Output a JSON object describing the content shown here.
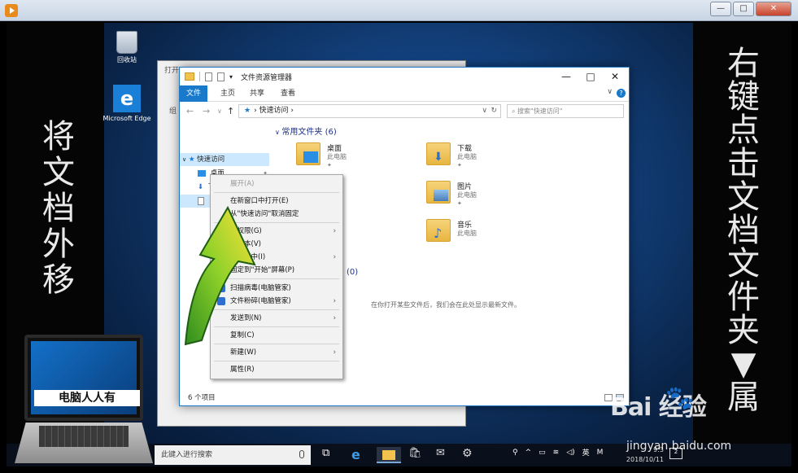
{
  "outer_window": {
    "controls": {
      "minimize": "—",
      "maximize": "□",
      "close": "✕"
    }
  },
  "left_caption": [
    "将",
    "文",
    "档",
    "外",
    "移"
  ],
  "right_caption": [
    "右",
    "键",
    "点",
    "击",
    "文",
    "档",
    "文",
    "件",
    "夹",
    "▼",
    "属"
  ],
  "desktop_icons": [
    {
      "label": "回收站"
    },
    {
      "label": "Microsoft Edge"
    }
  ],
  "back_window": {
    "title_partial": "打开",
    "row1": "组"
  },
  "explorer": {
    "title": "文件资源管理器",
    "ribbon_tabs": [
      "文件",
      "主页",
      "共享",
      "查看"
    ],
    "address": "快速访问",
    "search_placeholder": "搜索\"快速访问\"",
    "nav": [
      {
        "label": "快速访问",
        "selected": true
      },
      {
        "label": "桌面"
      },
      {
        "label": "下载"
      }
    ],
    "frequent_header": "常用文件夹 (6)",
    "folders": [
      {
        "name": "桌面",
        "sub": "此电脑"
      },
      {
        "name": "下载",
        "sub": "此电脑"
      },
      {
        "name": "图片",
        "sub": "此电脑"
      },
      {
        "name": "音乐",
        "sub": "此电脑"
      }
    ],
    "recent_header_partial": "(0)",
    "recent_empty": "在你打开某些文件后，我们会在此处显示最新文件。",
    "status": "6 个项目"
  },
  "context_menu": {
    "items": [
      {
        "label": "展开(A)",
        "disabled": true
      },
      {
        "label": "在新窗口中打开(E)"
      },
      {
        "label": "从\"快速访问\"取消固定"
      },
      {
        "label": "授予访问权限(G)",
        "visible": "问权限(G)",
        "submenu": true
      },
      {
        "label": "还原以前的版本(V)",
        "visible": "的版本(V)"
      },
      {
        "label": "包含到库中(I)",
        "visible": "含到库中(I)",
        "submenu": true
      },
      {
        "label": "固定到\"开始\"屏幕(P)"
      },
      {
        "label": "扫描病毒(电脑管家)"
      },
      {
        "label": "文件粉碎(电脑管家)",
        "submenu": true
      },
      {
        "label": "发送到(N)",
        "submenu": true
      },
      {
        "label": "复制(C)"
      },
      {
        "label": "新建(W)",
        "submenu": true
      },
      {
        "label": "属性(R)"
      }
    ]
  },
  "taskbar": {
    "search": "此键入进行搜索",
    "tray_lang": "英",
    "clock_time": "9:3",
    "clock_date": "2018/10/11",
    "notif_count": "2"
  },
  "laptop_logo_text": "电脑人人有",
  "watermark": {
    "brand": "Bai  经验",
    "url": "jingyan.baidu.com"
  }
}
